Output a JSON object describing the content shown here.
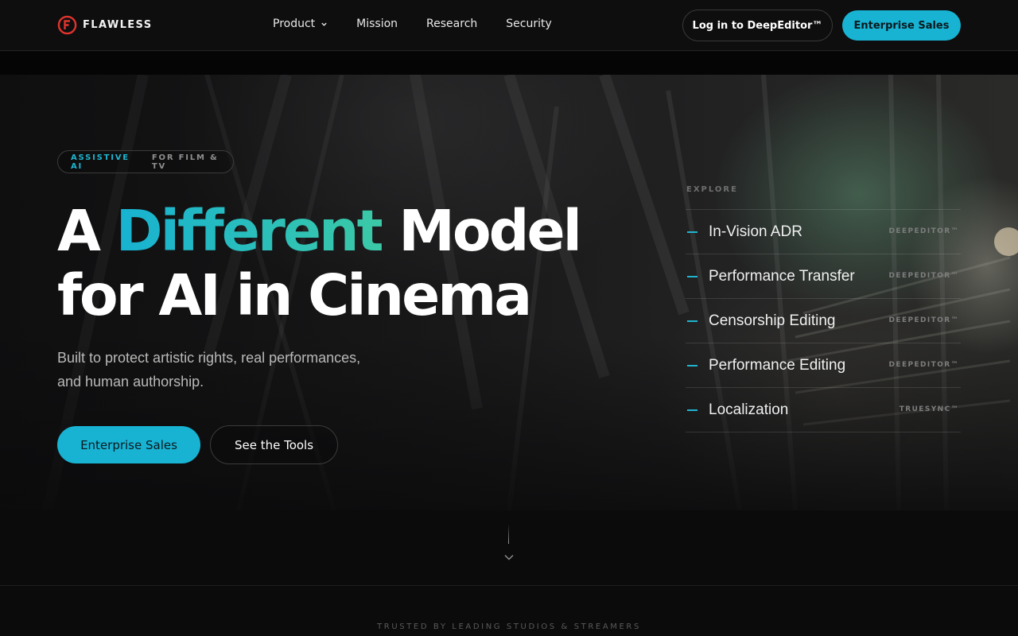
{
  "header": {
    "brand": "FLAWLESS",
    "nav": [
      {
        "label": "Product"
      },
      {
        "label": "Mission"
      },
      {
        "label": "Research"
      },
      {
        "label": "Security"
      }
    ],
    "login_label": "Log in to DeepEditor™",
    "enterprise_label": "Enterprise Sales"
  },
  "hero": {
    "pill_primary": "ASSISTIVE AI",
    "pill_secondary": "FOR FILM & TV",
    "headline_part1": "A ",
    "headline_highlight": "Different",
    "headline_part2": " Model",
    "headline_line2": "for AI in Cinema",
    "subtitle_line1": "Built to protect artistic rights, real performances,",
    "subtitle_line2": "and human authorship.",
    "cta_primary": "Enterprise Sales",
    "cta_secondary": "See the Tools"
  },
  "explore": {
    "label": "EXPLORE",
    "items": [
      {
        "title": "In-Vision ADR",
        "tag": "DEEPEDITOR™"
      },
      {
        "title": "Performance Transfer",
        "tag": "DEEPEDITOR™"
      },
      {
        "title": "Censorship Editing",
        "tag": "DEEPEDITOR™"
      },
      {
        "title": "Performance Editing",
        "tag": "DEEPEDITOR™"
      },
      {
        "title": "Localization",
        "tag": "TRUESYNC™"
      }
    ]
  },
  "footer": {
    "trusted": "TRUSTED BY LEADING STUDIOS & STREAMERS"
  },
  "colors": {
    "accent": "#18b3d3",
    "accent_green": "#3bc9a6",
    "logo_red": "#e0342c",
    "background": "#0b0b0c"
  }
}
